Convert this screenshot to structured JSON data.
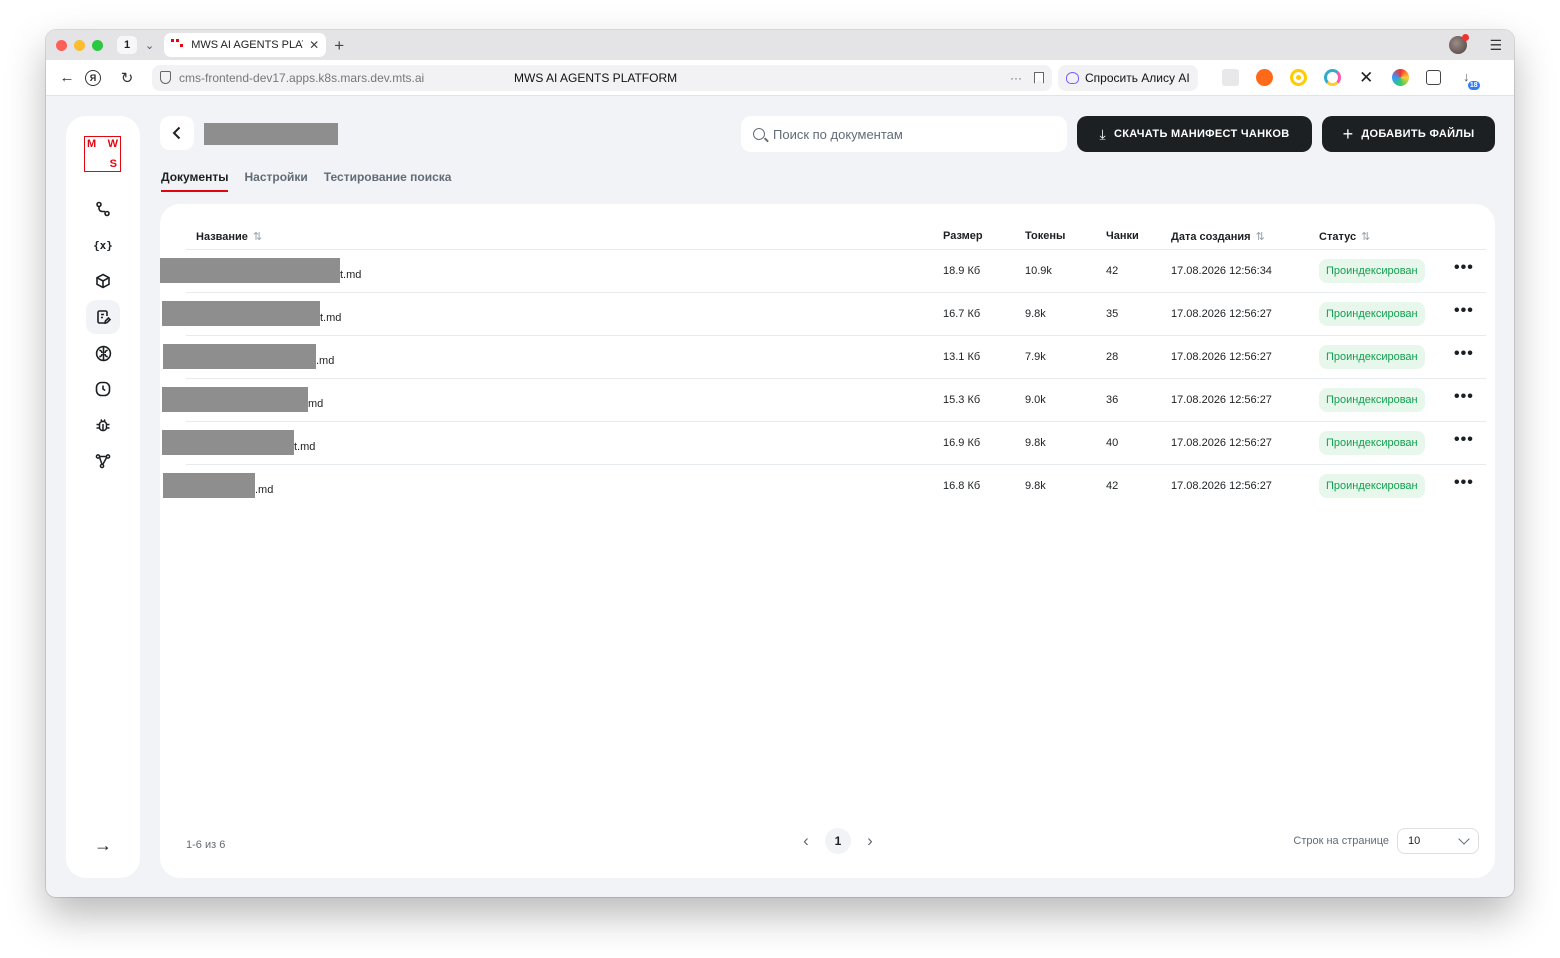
{
  "browser": {
    "tab_count": "1",
    "tab_title": "MWS AI AGENTS PLATF",
    "url": "cms-frontend-dev17.apps.k8s.mars.dev.mts.ai",
    "page_title": "MWS AI AGENTS PLATFORM",
    "alice_label": "Спросить Алису AI",
    "downloads_badge": "18"
  },
  "logo": {
    "l1": "M",
    "l2": "W",
    "l3": "S"
  },
  "header": {
    "search_placeholder": "Поиск по документам",
    "manifest_button": "Скачать манифест чанков",
    "add_button": "Добавить файлы"
  },
  "tabs": [
    {
      "label": "Документы",
      "active": true
    },
    {
      "label": "Настройки",
      "active": false
    },
    {
      "label": "Тестирование поиска",
      "active": false
    }
  ],
  "table": {
    "columns": {
      "name": "Название",
      "size": "Размер",
      "tokens": "Токены",
      "chunks": "Чанки",
      "created": "Дата создания",
      "status": "Статус"
    },
    "rows": [
      {
        "name_suffix": "t.md",
        "size": "18.9 Кб",
        "tokens": "10.9k",
        "chunks": "42",
        "created": "17.08.2026 12:56:34",
        "status": "Проиндексирован"
      },
      {
        "name_suffix": "t.md",
        "size": "16.7 Кб",
        "tokens": "9.8k",
        "chunks": "35",
        "created": "17.08.2026 12:56:27",
        "status": "Проиндексирован"
      },
      {
        "name_suffix": ".md",
        "size": "13.1 Кб",
        "tokens": "7.9k",
        "chunks": "28",
        "created": "17.08.2026 12:56:27",
        "status": "Проиндексирован"
      },
      {
        "name_suffix": "md",
        "size": "15.3 Кб",
        "tokens": "9.0k",
        "chunks": "36",
        "created": "17.08.2026 12:56:27",
        "status": "Проиндексирован"
      },
      {
        "name_suffix": "t.md",
        "size": "16.9 Кб",
        "tokens": "9.8k",
        "chunks": "40",
        "created": "17.08.2026 12:56:27",
        "status": "Проиндексирован"
      },
      {
        "name_suffix": ".md",
        "size": "16.8 Кб",
        "tokens": "9.8k",
        "chunks": "42",
        "created": "17.08.2026 12:56:27",
        "status": "Проиндексирован"
      }
    ]
  },
  "footer": {
    "range": "1-6 из 6",
    "current_page": "1",
    "rows_per_page_label": "Строк на странице",
    "rows_per_page_value": "10"
  },
  "colors": {
    "brand": "#e30611",
    "dark": "#1d2023",
    "success_bg": "#e8f7ec",
    "success_text": "#12a04f"
  }
}
